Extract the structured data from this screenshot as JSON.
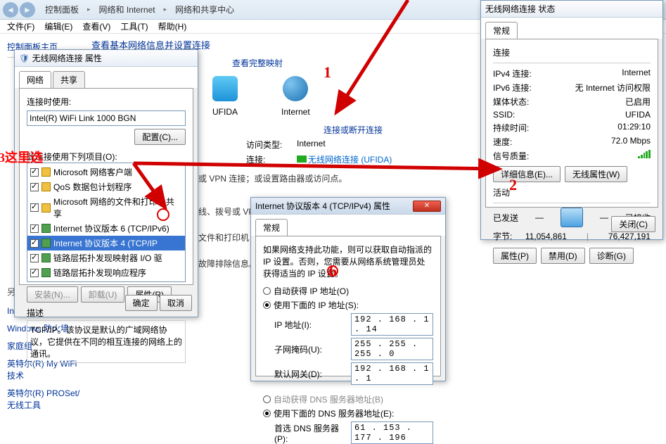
{
  "breadcrumb": {
    "a": "控制面板",
    "b": "网络和 Internet",
    "c": "网络和共享中心"
  },
  "menu": {
    "file": "文件(F)",
    "edit": "编辑(E)",
    "view": "查看(V)",
    "tools": "工具(T)",
    "help": "帮助(H)"
  },
  "left": {
    "header": "控制面板主页",
    "see_also": "另请参阅",
    "links": [
      "Internet 选项",
      "Windows 防火墙",
      "家庭组",
      "英特尔(R) My WiFi 技术",
      "英特尔(R) PROSet/无线工具"
    ]
  },
  "main": {
    "title": "查看基本网络信息并设置连接",
    "map": "查看完整映射",
    "net1": "UFIDA",
    "net2": "Internet",
    "connect": "连接或断开连接",
    "lbl_type": "访问类型:",
    "val_type": "Internet",
    "lbl_conn": "连接:",
    "val_conn": "无线网络连接 (UFIDA)",
    "sub1": "时或 VPN 连接；或设置路由器或访问点。",
    "sub2": "有线、拨号或 VP",
    "sub3": "之文件和打印机，",
    "sub4": "排故障排除信息。"
  },
  "dlg1": {
    "title": "无线网络连接 属性",
    "tab1": "网络",
    "tab2": "共享",
    "lbl_conn": "连接时使用:",
    "adapter": "Intel(R) WiFi Link 1000 BGN",
    "cfg": "配置(C)...",
    "lbl_items": "此连接使用下列项目(O):",
    "items": [
      "Microsoft 网络客户端",
      "QoS 数据包计划程序",
      "Microsoft 网络的文件和打印机共享",
      "Internet 协议版本 6 (TCP/IPv6)",
      "Internet 协议版本 4 (TCP/IP",
      "链路层拓扑发现映射器 I/O 驱",
      "链路层拓扑发现响应程序"
    ],
    "install": "安装(N)...",
    "uninstall": "卸载(U)",
    "props": "属性(R)",
    "desc_lbl": "描述",
    "desc": "TCP/IP。该协议是默认的广域网络协议，它提供在不同的相互连接的网络上的通讯。",
    "ok": "确定",
    "cancel": "取消"
  },
  "dlg2": {
    "titlebar": "无线网络连接 状态",
    "tab": "常规",
    "sect_conn": "连接",
    "k_ipv4": "IPv4 连接:",
    "v_ipv4": "Internet",
    "k_ipv6": "IPv6 连接:",
    "v_ipv6": "无 Internet 访问权限",
    "k_media": "媒体状态:",
    "v_media": "已启用",
    "k_ssid": "SSID:",
    "v_ssid": "UFIDA",
    "k_dur": "持续时间:",
    "v_dur": "01:29:10",
    "k_speed": "速度:",
    "v_speed": "72.0 Mbps",
    "k_sig": "信号质量:",
    "details": "详细信息(E)...",
    "wprops": "无线属性(W)",
    "sect_act": "活动",
    "sent": "已发送",
    "recv": "已接收",
    "bytes": "字节:",
    "v_sent": "11,054,861",
    "v_recv": "76,427,191",
    "b_props": "属性(P)",
    "b_disable": "禁用(D)",
    "b_diag": "诊断(G)",
    "close": "关闭(C)"
  },
  "dlg3": {
    "title": "Internet 协议版本 4 (TCP/IPv4) 属性",
    "tab": "常规",
    "intro": "如果网络支持此功能，则可以获取自动指派的 IP 设置。否则，您需要从网络系统管理员处获得适当的 IP 设置。",
    "r1": "自动获得 IP 地址(O)",
    "r2": "使用下面的 IP 地址(S):",
    "l_ip": "IP 地址(I):",
    "v_ip": "192 . 168 .  1  . 14",
    "l_mask": "子网掩码(U):",
    "v_mask": "255 . 255 . 255 .  0",
    "l_gw": "默认网关(D):",
    "v_gw": "192 . 168 .  1  .  1",
    "r3": "自动获得 DNS 服务器地址(B)",
    "r4": "使用下面的 DNS 服务器地址(E):",
    "l_dns1": "首选 DNS 服务器(P):",
    "v_dns1": "61  . 153 . 177 . 196"
  },
  "anno": {
    "n1": "1",
    "n2": "2",
    "n3": "3这里选",
    "n6": "6"
  }
}
